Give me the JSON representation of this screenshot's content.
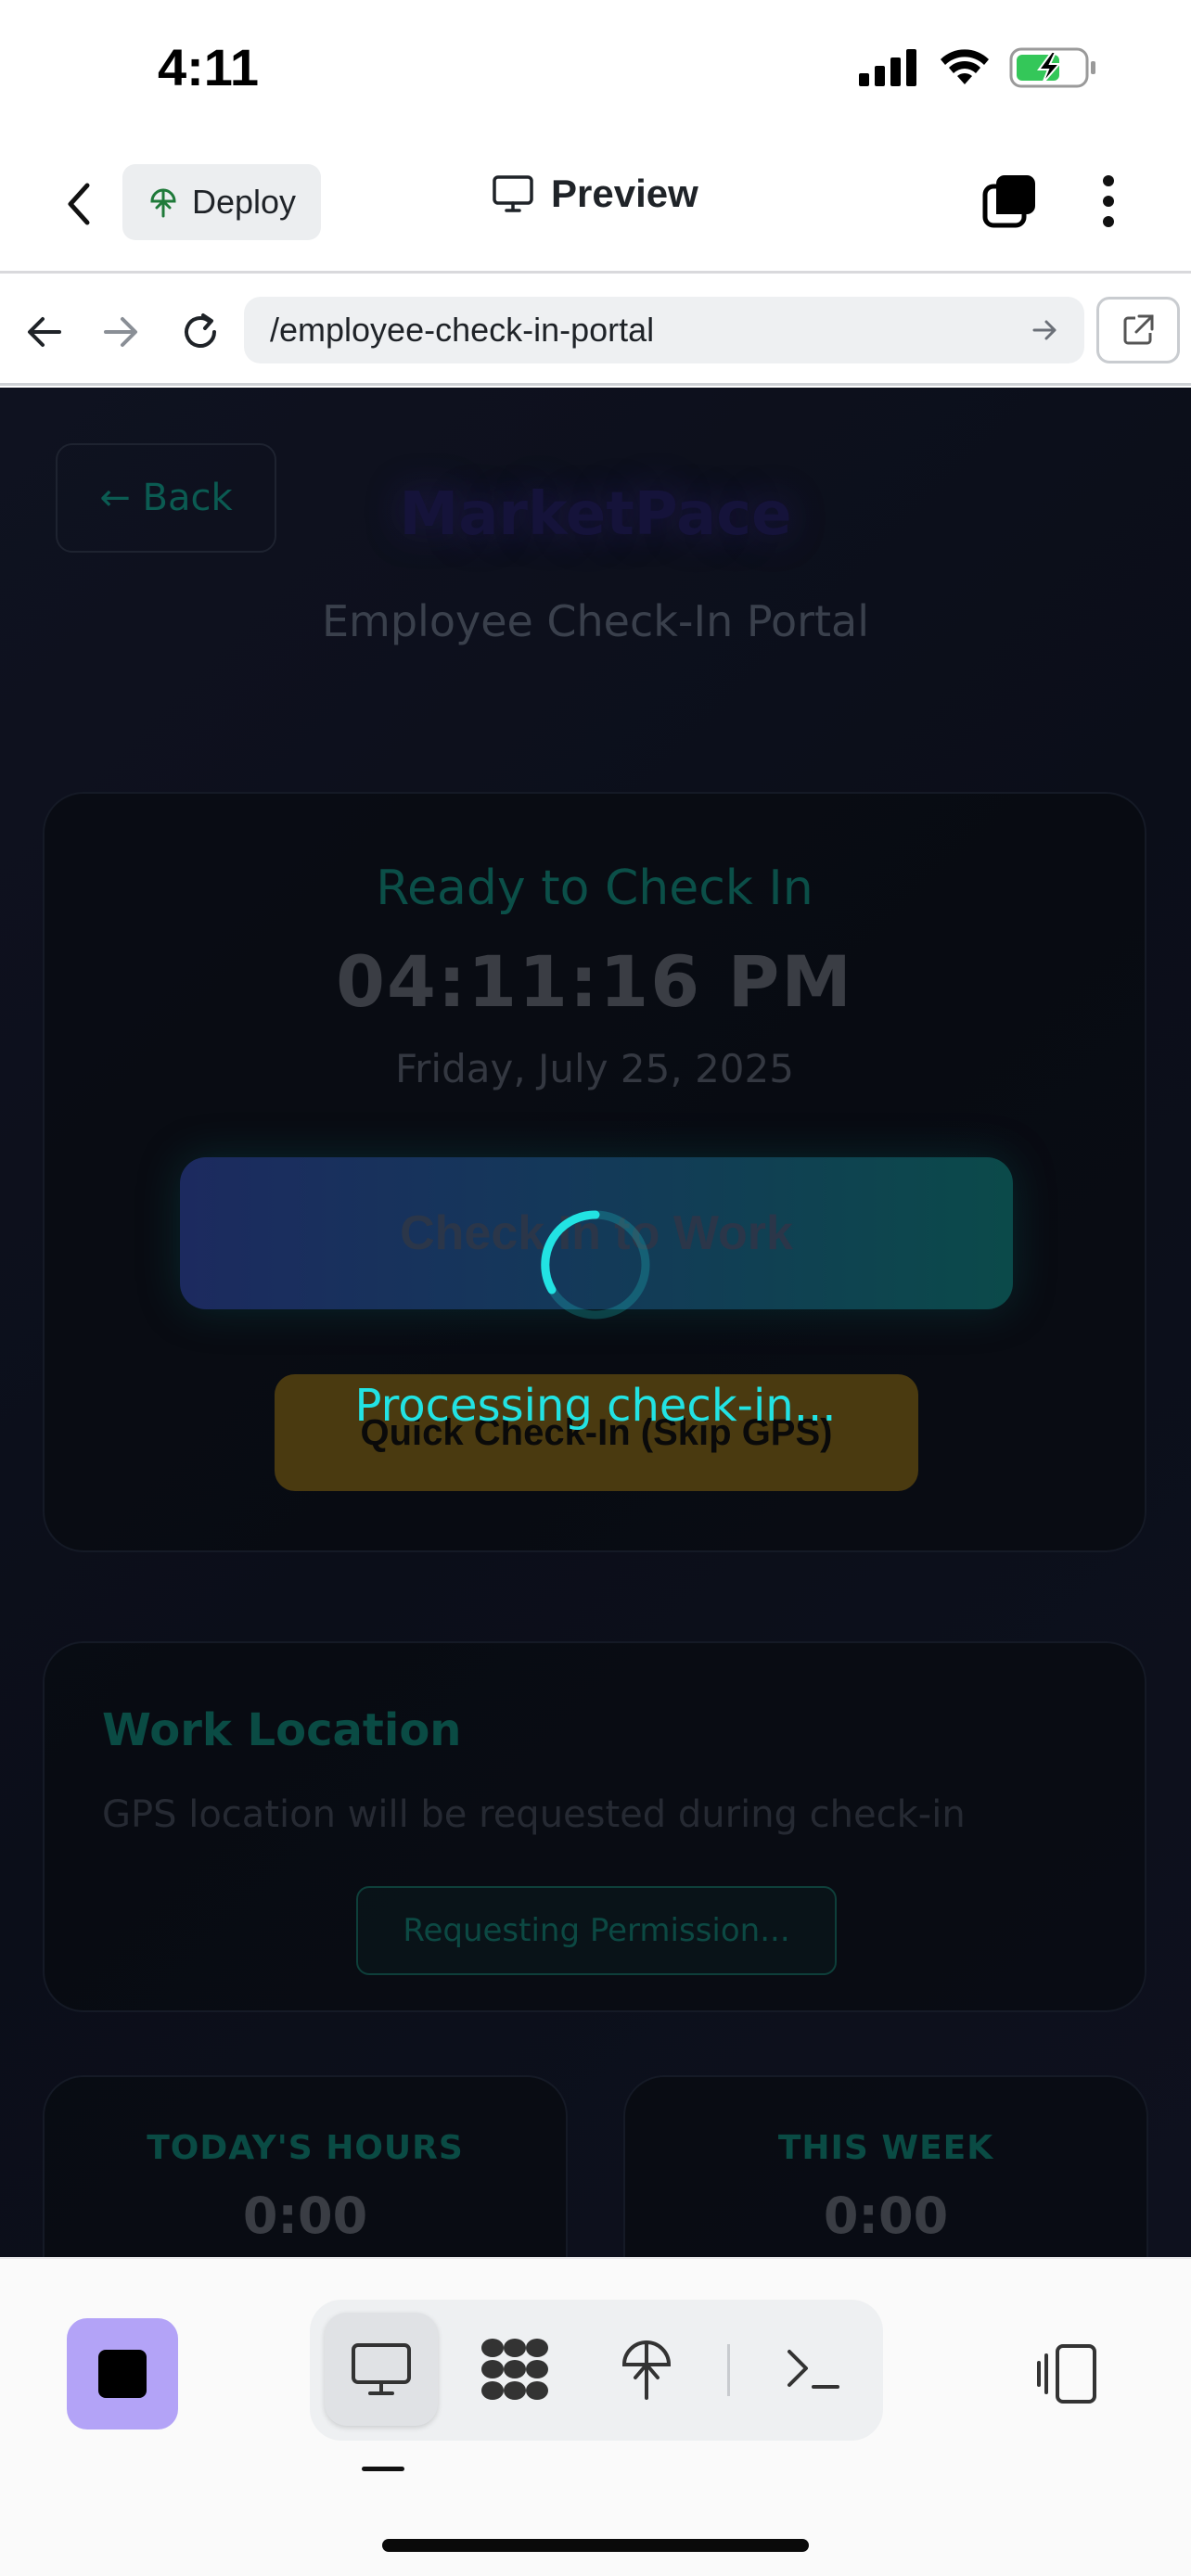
{
  "status_bar": {
    "time": "4:11"
  },
  "toolbar": {
    "deploy_label": "Deploy",
    "preview_label": "Preview"
  },
  "browser": {
    "url": "/employee-check-in-portal"
  },
  "page": {
    "back_label": "← Back",
    "brand": "MarketPace",
    "subtitle": "Employee Check-In Portal",
    "checkin": {
      "status": "Ready to Check In",
      "time": "04:11:16 PM",
      "date": "Friday, July 25, 2025",
      "primary_button": "Check In to Work",
      "quick_button": "Quick Check-In (Skip GPS)"
    },
    "location": {
      "title": "Work Location",
      "description": "GPS location will be requested during check-in",
      "permission_button": "Requesting Permission..."
    },
    "stats": [
      {
        "label": "TODAY'S HOURS",
        "value": "0:00"
      },
      {
        "label": "THIS WEEK",
        "value": "0:00"
      }
    ]
  },
  "overlay": {
    "message": "Processing check-in..."
  },
  "colors": {
    "accent_cyan": "#22e3e3",
    "stop_button": "#b3a3f7",
    "battery_green": "#34c759"
  },
  "bottom_bar": {
    "icons": [
      "stop-icon",
      "desktop-icon",
      "apps-icon",
      "deploy-icon",
      "terminal-icon",
      "layout-toggle-icon"
    ]
  }
}
